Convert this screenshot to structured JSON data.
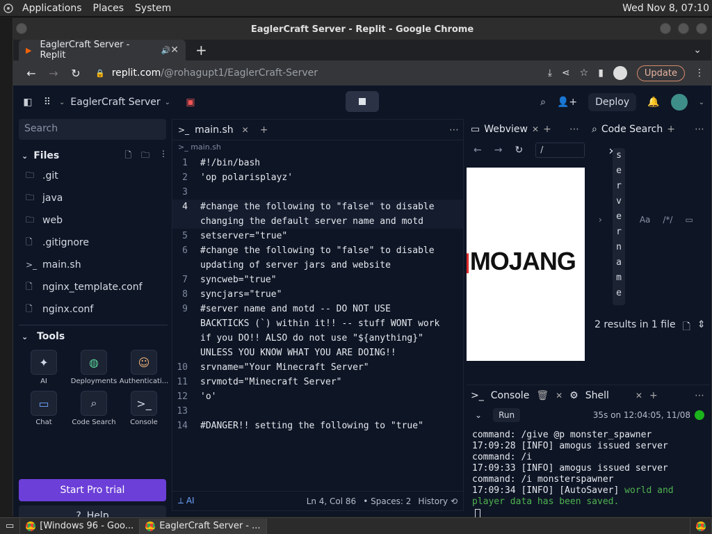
{
  "os_bar": {
    "menus": [
      "Applications",
      "Places",
      "System"
    ],
    "clock": "Wed Nov 8, 07:10"
  },
  "browser": {
    "window_title": "EaglerCraft Server - Replit - Google Chrome",
    "tab_title": "EaglerCraft Server - Replit",
    "url_host": "replit.com",
    "url_path": "/@rohagupt1/EaglerCraft-Server",
    "update_label": "Update"
  },
  "replit": {
    "project_name": "EaglerCraft Server",
    "deploy_label": "Deploy",
    "search_placeholder": "Search",
    "files_label": "Files",
    "files": [
      {
        "name": ".git",
        "kind": "folder"
      },
      {
        "name": "java",
        "kind": "folder"
      },
      {
        "name": "web",
        "kind": "folder"
      },
      {
        "name": ".gitignore",
        "kind": "file"
      },
      {
        "name": "main.sh",
        "kind": "shell"
      },
      {
        "name": "nginx_template.conf",
        "kind": "file"
      },
      {
        "name": "nginx.conf",
        "kind": "file"
      }
    ],
    "tools_label": "Tools",
    "tools": [
      {
        "label": "AI",
        "icon": "ai-icon"
      },
      {
        "label": "Deployments",
        "icon": "globe-icon"
      },
      {
        "label": "Authenticati...",
        "icon": "user-icon"
      },
      {
        "label": "Chat",
        "icon": "chat-icon"
      },
      {
        "label": "Code Search",
        "icon": "search-icon"
      },
      {
        "label": "Console",
        "icon": "terminal-icon"
      }
    ],
    "pro_trial_label": "Start Pro trial",
    "help_label": "Help"
  },
  "editor": {
    "tab_name": "main.sh",
    "breadcrumb": "main.sh",
    "lines": [
      {
        "n": "1",
        "text": "#!/bin/bash",
        "cls": "sh"
      },
      {
        "n": "2",
        "text": "'op polarisplayz'",
        "cls": "st"
      },
      {
        "n": "3",
        "text": "",
        "cls": ""
      },
      {
        "n": "4",
        "text": "#change the following to \"false\" to disable changing the default server name and motd",
        "cls": "cm"
      },
      {
        "n": "5",
        "text": "setserver=\"true\"",
        "cls": ""
      },
      {
        "n": "6",
        "text": "#change the following to \"false\" to disable updating of server jars and website",
        "cls": "cm"
      },
      {
        "n": "7",
        "text": "syncweb=\"true\"",
        "cls": ""
      },
      {
        "n": "8",
        "text": "syncjars=\"true\"",
        "cls": ""
      },
      {
        "n": "9",
        "text": "#server name and motd -- DO NOT USE BACKTICKS (`) within it!! -- stuff WONT work if you DO!! ALSO do not use \"${anything}\" UNLESS YOU KNOW WHAT YOU ARE DOING!!",
        "cls": "cm"
      },
      {
        "n": "10",
        "text": "srvname=\"Your Minecraft Server\"",
        "cls": ""
      },
      {
        "n": "11",
        "text": "srvmotd=\"Minecraft Server\"",
        "cls": ""
      },
      {
        "n": "12",
        "text": "'o'",
        "cls": "st"
      },
      {
        "n": "13",
        "text": "",
        "cls": ""
      },
      {
        "n": "14",
        "text": "#DANGER!! setting the following to \"true\"",
        "cls": "cm"
      }
    ],
    "status": {
      "ai": "AI",
      "position": "Ln 4, Col 86",
      "spaces": "Spaces: 2",
      "history": "History"
    }
  },
  "webview": {
    "tab_label": "Webview",
    "url": "/",
    "logo_text": "MOJANG"
  },
  "code_search": {
    "tab_label": "Code Search",
    "query": "servername",
    "results": "2 results in 1 file"
  },
  "console": {
    "tab_console": "Console",
    "tab_shell": "Shell",
    "run_label": "Run",
    "run_time": "35s on 12:04:05, 11/08",
    "output": [
      {
        "text": "command: /give @p monster_spawner",
        "green": false
      },
      {
        "text": "17:09:28 [INFO] amogus issued server",
        "green": false
      },
      {
        "text": "command: /i",
        "green": false
      },
      {
        "text": "17:09:33 [INFO] amogus issued server",
        "green": false
      },
      {
        "text": "command: /i monsterspawner",
        "green": false
      },
      {
        "text": "17:09:34 [INFO] [AutoSaver]",
        "green": false
      },
      {
        "text": " world and player data has been saved.",
        "green": true
      }
    ]
  },
  "taskbar": {
    "items": [
      "[Windows 96 - Goo...",
      "EaglerCraft Server - ..."
    ]
  }
}
